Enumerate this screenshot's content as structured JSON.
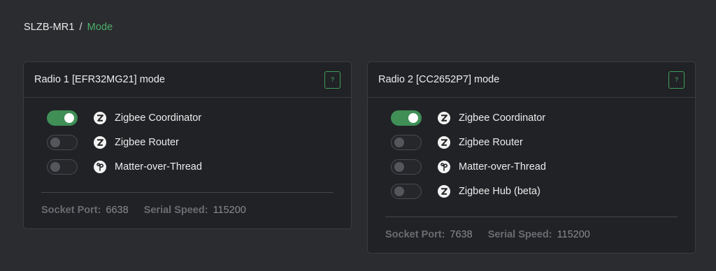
{
  "breadcrumb": {
    "root": "SLZB-MR1",
    "separator": "/",
    "current": "Mode"
  },
  "colors": {
    "accent": "#4caf6a",
    "background": "#2b2c2f",
    "card": "#212225"
  },
  "cards": [
    {
      "title": "Radio 1 [EFR32MG21] mode",
      "help_label": "?",
      "options": [
        {
          "label": "Zigbee Coordinator",
          "icon": "zigbee-icon",
          "enabled": true
        },
        {
          "label": "Zigbee Router",
          "icon": "zigbee-icon",
          "enabled": false
        },
        {
          "label": "Matter-over-Thread",
          "icon": "thread-icon",
          "enabled": false
        }
      ],
      "socket_port_label": "Socket Port:",
      "socket_port": "6638",
      "serial_speed_label": "Serial Speed:",
      "serial_speed": "115200"
    },
    {
      "title": "Radio 2 [CC2652P7] mode",
      "help_label": "?",
      "options": [
        {
          "label": "Zigbee Coordinator",
          "icon": "zigbee-icon",
          "enabled": true
        },
        {
          "label": "Zigbee Router",
          "icon": "zigbee-icon",
          "enabled": false
        },
        {
          "label": "Matter-over-Thread",
          "icon": "thread-icon",
          "enabled": false
        },
        {
          "label": "Zigbee Hub (beta)",
          "icon": "zigbee-icon",
          "enabled": false
        }
      ],
      "socket_port_label": "Socket Port:",
      "socket_port": "7638",
      "serial_speed_label": "Serial Speed:",
      "serial_speed": "115200"
    }
  ]
}
